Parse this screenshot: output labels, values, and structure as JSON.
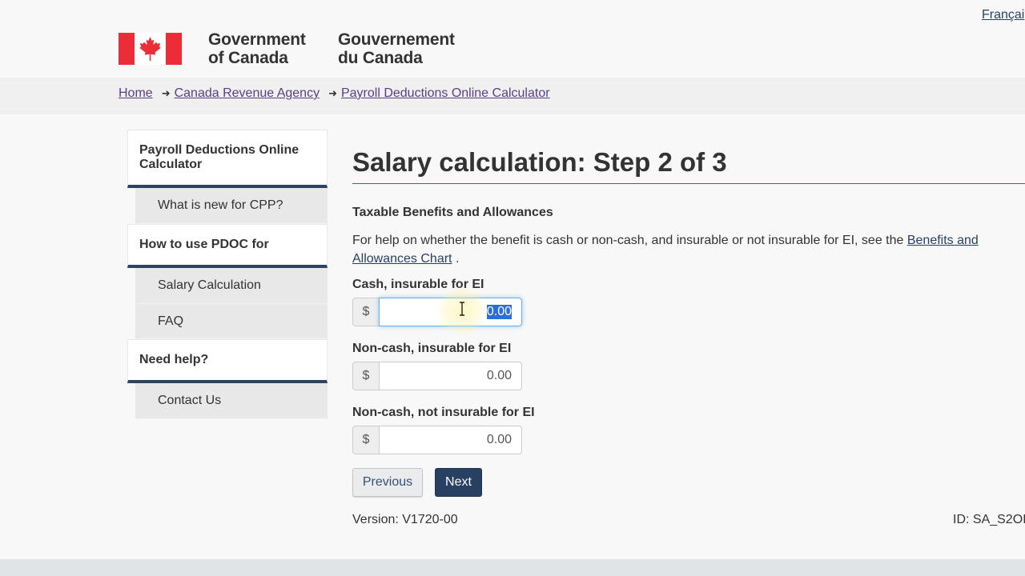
{
  "header": {
    "lang_toggle": "Françai",
    "wordmark_en": [
      "Government",
      "of Canada"
    ],
    "wordmark_fr": [
      "Gouvernement",
      "du Canada"
    ],
    "flag_red": "#eb2d37"
  },
  "breadcrumb": [
    {
      "label": "Home"
    },
    {
      "label": "Canada Revenue Agency"
    },
    {
      "label": "Payroll Deductions Online Calculator"
    }
  ],
  "sidebar": {
    "sections": [
      {
        "title": "Payroll Deductions Online Calculator",
        "items": [
          "What is new for CPP?"
        ]
      },
      {
        "title": "How to use PDOC for",
        "items": [
          "Salary Calculation",
          "FAQ"
        ]
      },
      {
        "title": "Need help?",
        "items": [
          "Contact Us"
        ]
      }
    ]
  },
  "main": {
    "title": "Salary calculation: Step 2 of 3",
    "section_heading": "Taxable Benefits and Allowances",
    "help_text": "For help on whether the benefit is cash or non-cash, and insurable or not insurable for EI, see the",
    "help_link": "Benefits and Allowances Chart",
    "help_suffix": ".",
    "fields": [
      {
        "label": "Cash, insurable for EI",
        "prefix": "$",
        "value": "0.00",
        "focused": true
      },
      {
        "label": "Non-cash, insurable for EI",
        "prefix": "$",
        "value": "0.00"
      },
      {
        "label": "Non-cash, not insurable for EI",
        "prefix": "$",
        "value": "0.00"
      }
    ],
    "buttons": {
      "previous": "Previous",
      "next": "Next"
    },
    "version": "Version: V1720-00",
    "page_id": "ID: SA_S2OI"
  },
  "colors": {
    "accent_navy": "#284162",
    "title_rule": "#af3c43",
    "visited_link": "#5a3e85"
  }
}
